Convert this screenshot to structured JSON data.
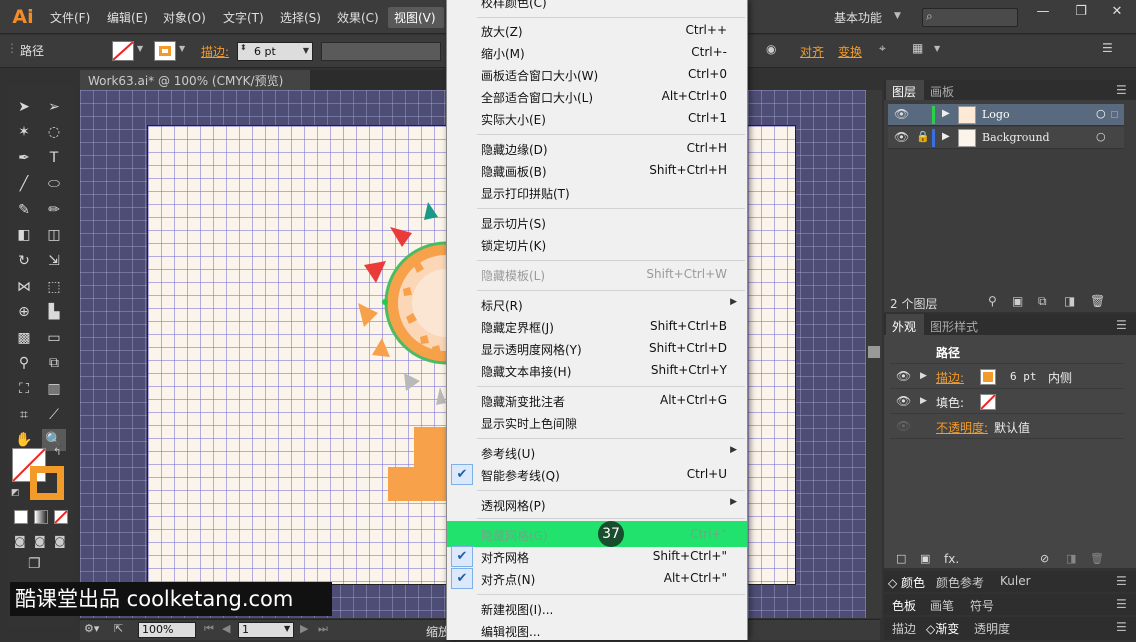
{
  "app": {
    "logo": "Ai"
  },
  "menubar": {
    "items": [
      "文件(F)",
      "编辑(E)",
      "对象(O)",
      "文字(T)",
      "选择(S)",
      "效果(C)",
      "视图(V)"
    ],
    "workspace": "基本功能",
    "window_controls": [
      "—",
      "❐",
      "✕"
    ]
  },
  "control_bar": {
    "selection_type": "路径",
    "stroke_label": "描边:",
    "stroke_weight": "6 pt",
    "align_label": "对齐",
    "transform_label": "变换"
  },
  "document": {
    "tab_title": "Work63.ai* @ 100% (CMYK/预览)"
  },
  "status_bar": {
    "zoom": "100%",
    "artboard_number": "1",
    "status_text": "缩放"
  },
  "view_menu": {
    "top_partial": "校样颜色(C)",
    "items": [
      {
        "label": "放大(Z)",
        "shortcut": "Ctrl++"
      },
      {
        "label": "缩小(M)",
        "shortcut": "Ctrl+-"
      },
      {
        "label": "画板适合窗口大小(W)",
        "shortcut": "Ctrl+0"
      },
      {
        "label": "全部适合窗口大小(L)",
        "shortcut": "Alt+Ctrl+0"
      },
      {
        "label": "实际大小(E)",
        "shortcut": "Ctrl+1"
      },
      {
        "label": "隐藏边缘(D)",
        "shortcut": "Ctrl+H"
      },
      {
        "label": "隐藏画板(B)",
        "shortcut": "Shift+Ctrl+H"
      },
      {
        "label": "显示打印拼贴(T)",
        "shortcut": ""
      },
      {
        "label": "显示切片(S)",
        "shortcut": ""
      },
      {
        "label": "锁定切片(K)",
        "shortcut": ""
      },
      {
        "label": "隐藏模板(L)",
        "shortcut": "Shift+Ctrl+W"
      },
      {
        "label": "标尺(R)",
        "shortcut": ""
      },
      {
        "label": "隐藏定界框(J)",
        "shortcut": "Shift+Ctrl+B"
      },
      {
        "label": "显示透明度网格(Y)",
        "shortcut": "Shift+Ctrl+D"
      },
      {
        "label": "隐藏文本串接(H)",
        "shortcut": "Shift+Ctrl+Y"
      },
      {
        "label": "隐藏渐变批注者",
        "shortcut": "Alt+Ctrl+G"
      },
      {
        "label": "显示实时上色间隙",
        "shortcut": ""
      },
      {
        "label": "参考线(U)",
        "shortcut": ""
      },
      {
        "label": "智能参考线(Q)",
        "shortcut": "Ctrl+U"
      },
      {
        "label": "透视网格(P)",
        "shortcut": ""
      },
      {
        "label": "隐藏网格(G)",
        "shortcut": "Ctrl+\""
      },
      {
        "label": "对齐网格",
        "shortcut": "Shift+Ctrl+\""
      },
      {
        "label": "对齐点(N)",
        "shortcut": "Alt+Ctrl+\""
      },
      {
        "label": "新建视图(I)...",
        "shortcut": ""
      },
      {
        "label": "编辑视图...",
        "shortcut": ""
      }
    ]
  },
  "step_badge": "37",
  "layers_panel": {
    "tabs": [
      "图层",
      "画板"
    ],
    "layers": [
      "Logo",
      "Background"
    ],
    "count": "2 个图层"
  },
  "appearance_panel": {
    "tabs": [
      "外观",
      "图形样式"
    ],
    "title": "路径",
    "stroke_label": "描边:",
    "stroke_value": "6 pt",
    "stroke_position": "内侧",
    "fill_label": "填色:",
    "opacity_label": "不透明度:",
    "opacity_value": "默认值"
  },
  "bottom_panels": {
    "row1": [
      "颜色",
      "颜色参考",
      "Kuler"
    ],
    "row2": [
      "色板",
      "画笔",
      "符号"
    ],
    "row3": [
      "描边",
      "渐变",
      "透明度"
    ]
  },
  "watermark": "酷课堂出品 coolketang.com",
  "colors": {
    "accent_orange": "#f29b2b",
    "menu_highlight": "#22e26e",
    "canvas_grid": "#4e4d75"
  }
}
